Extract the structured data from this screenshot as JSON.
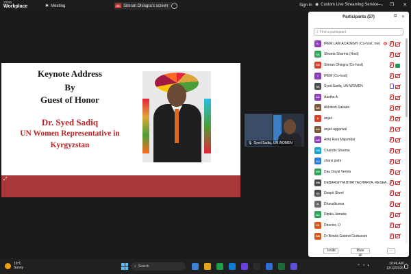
{
  "topbar": {
    "brand_line1": "zoom",
    "brand_line2": "Workplace",
    "meeting_label": "Meeting",
    "share_avatar": "SD",
    "share_label": "Simran Dhingra's screen",
    "more": "···",
    "signin": "Sign In",
    "stream_label": "Custom Live Streaming Service",
    "stream_chevron": "⌄",
    "win_minimize": "—",
    "win_restore": "❐",
    "win_close": "✕"
  },
  "slide": {
    "line1": "Keynote Address",
    "line2": "By",
    "line3": "Guest of Honor",
    "name": "Dr. Syed Sadiq",
    "role1": "UN Women Representative in",
    "role2": "Kyrgyzstan"
  },
  "video_tile": {
    "name": "Syed Sadiq, UN WOMEN"
  },
  "participants": {
    "title": "Participants (57)",
    "search_placeholder": "Find a participant",
    "items": [
      {
        "initials": "IL",
        "name": "IPEM LAW ACADEMY (Co-host, me)",
        "color": "#8a3fb8",
        "mic": "off",
        "cam": "off",
        "rec": true
      },
      {
        "initials": "SS",
        "name": "Shweta Sharma (Host)",
        "color": "#2fa35a",
        "mic": "off",
        "cam": "off"
      },
      {
        "initials": "SD",
        "name": "Simran Dhingra (Co-host)",
        "color": "#d6422e",
        "mic": "off",
        "cam": "on"
      },
      {
        "initials": "I",
        "name": "IPEM (Co-host)",
        "color": "#8a3fb8",
        "mic": "off",
        "cam": "off"
      },
      {
        "initials": "SS",
        "name": "Syed Sadiq, UN WOMEN",
        "color": "#4a4a4a",
        "mic": "on",
        "cam": "off"
      },
      {
        "initials": "AA",
        "name": "Aastha A",
        "color": "#8a3fb8",
        "mic": "off",
        "cam": "off"
      },
      {
        "initials": "AK",
        "name": "Akhilesh Kakade",
        "color": "#7a5a3a",
        "mic": "off",
        "cam": "off"
      },
      {
        "initials": "A",
        "name": "anjali",
        "color": "#d6422e",
        "mic": "off",
        "cam": "off"
      },
      {
        "initials": "AA",
        "name": "anjali aggarwal",
        "color": "#7a5a3a",
        "mic": "off",
        "cam": "off"
      },
      {
        "initials": "AR",
        "name": "Antu Rani Majumdar",
        "color": "#8a3fb8",
        "mic": "off",
        "cam": "off"
      },
      {
        "initials": "CS",
        "name": "Chandni Sharma",
        "color": "#1ba6c9",
        "mic": "off",
        "cam": "off"
      },
      {
        "initials": "CJ",
        "name": "charvi joshi",
        "color": "#2d7fd6",
        "mic": "off",
        "cam": "off"
      },
      {
        "initials": "DD",
        "name": "Dau Dayal Verma",
        "color": "#2fa35a",
        "mic": "off",
        "cam": "off"
      },
      {
        "initials": "DB",
        "name": "DEBARGHYA BHATTACHARYA, RESEARCH...",
        "color": "#4a4a4a",
        "mic": "off",
        "cam": "off"
      },
      {
        "initials": "DS",
        "name": "Deepit Sheel",
        "color": "#4a4a4a",
        "mic": "off",
        "cam": "off"
      },
      {
        "initials": "D",
        "name": "Dhavalkumar",
        "color": "#6a6a6a",
        "mic": "off",
        "cam": "off"
      },
      {
        "initials": "DJ",
        "name": "Dipika Jamatia",
        "color": "#2fa35a",
        "mic": "off",
        "cam": "off"
      },
      {
        "initials": "DI",
        "name": "Director, IJ",
        "color": "#d65a1e",
        "mic": "off",
        "cam": "off"
      },
      {
        "initials": "DB",
        "name": "Dr Brinda Gobind Gurbuxani",
        "color": "#d65a1e",
        "mic": "off",
        "cam": "off"
      }
    ],
    "invite": "Invite",
    "mute_all": "Mute all",
    "more": "···"
  },
  "taskbar": {
    "temp": "19°C",
    "weather": "Sunny",
    "search": "Search",
    "time": "10:46 AM",
    "date": "12/12/2025",
    "tray_chevron": "⌃",
    "tray_wifi": "◔",
    "tray_sound": "◖",
    "icons": [
      "#3b82d6",
      "#e6a21a",
      "#1e9e4a",
      "#0f7bd8",
      "#6b3ee0",
      "#2b2b2b",
      "#2d6fd6",
      "#1d6b3a",
      "#5a4fd6"
    ]
  }
}
